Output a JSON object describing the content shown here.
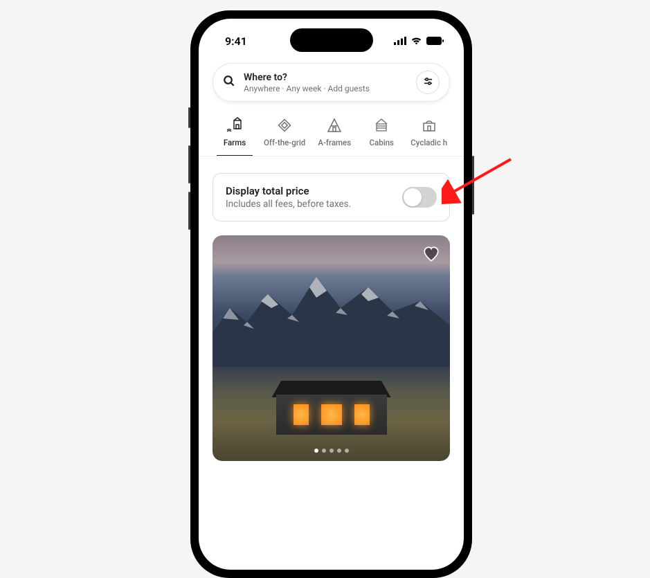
{
  "status": {
    "time": "9:41"
  },
  "search": {
    "title": "Where to?",
    "subtitle": "Anywhere · Any week · Add guests"
  },
  "categories": [
    {
      "label": "Farms",
      "active": true
    },
    {
      "label": "Off-the-grid",
      "active": false
    },
    {
      "label": "A-frames",
      "active": false
    },
    {
      "label": "Cabins",
      "active": false
    },
    {
      "label": "Cycladic h",
      "active": false
    }
  ],
  "price_toggle": {
    "title": "Display total price",
    "subtitle": "Includes all fees, before taxes.",
    "on": false
  },
  "listing": {
    "carousel_index": 0,
    "carousel_count": 5
  }
}
